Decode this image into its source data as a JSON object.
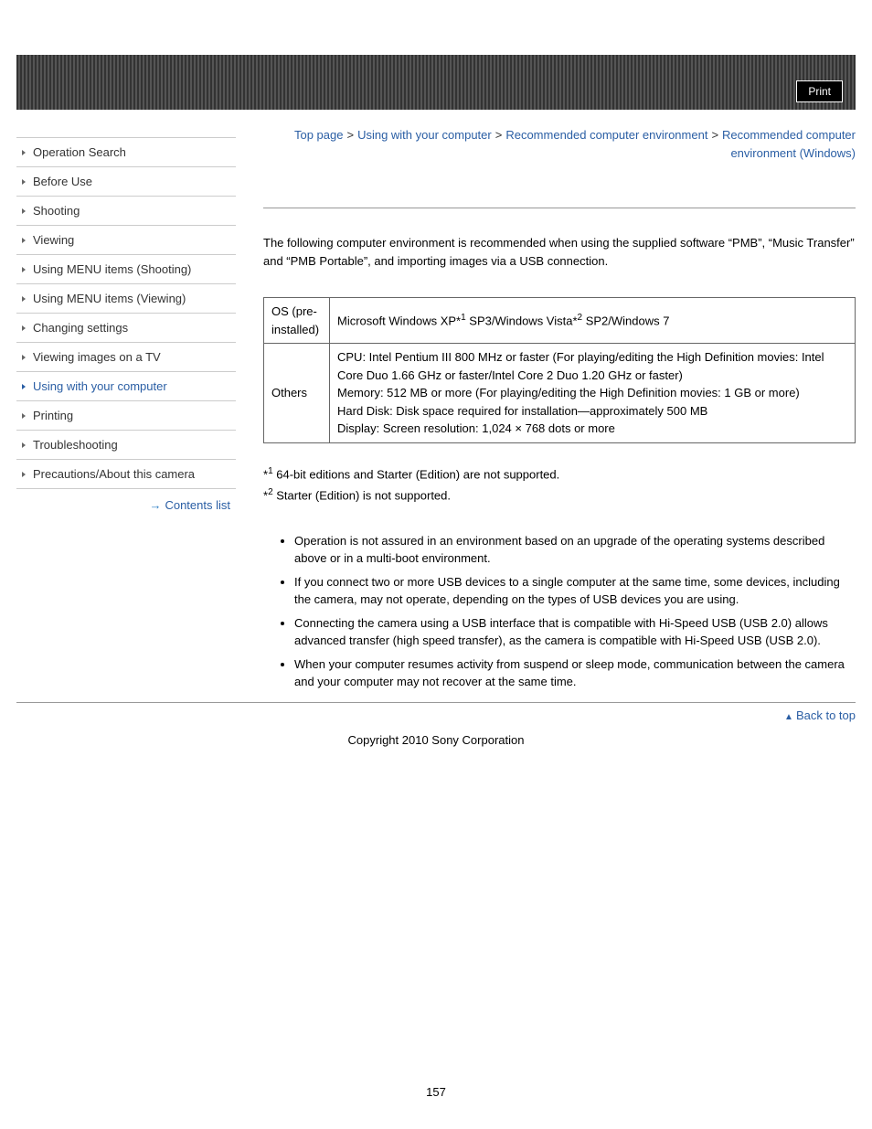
{
  "header": {
    "print": "Print"
  },
  "sidebar": {
    "items": [
      "Operation Search",
      "Before Use",
      "Shooting",
      "Viewing",
      "Using MENU items (Shooting)",
      "Using MENU items (Viewing)",
      "Changing settings",
      "Viewing images on a TV",
      "Using with your computer",
      "Printing",
      "Troubleshooting",
      "Precautions/About this camera"
    ],
    "contents_list": "Contents list"
  },
  "breadcrumb": {
    "l1": "Top page",
    "l2": "Using with your computer",
    "l3": "Recommended computer environment",
    "l4": "Recommended computer environment (Windows)",
    "sep": ">"
  },
  "intro": "The following computer environment is recommended when using the supplied software “PMB”, “Music Transfer” and “PMB Portable”, and importing images via a USB connection.",
  "table": {
    "r1": {
      "label": "OS (pre-installed)",
      "c1": "Microsoft Windows XP*",
      "sup1": "1",
      "c2": " SP3/Windows Vista*",
      "sup2": "2",
      "c3": " SP2/Windows 7"
    },
    "r2": {
      "label": "Others",
      "cpu": "CPU: Intel Pentium III 800 MHz or faster (For playing/editing the High Definition movies: Intel Core Duo 1.66 GHz or faster/Intel Core 2 Duo 1.20 GHz or faster)",
      "mem": "Memory: 512 MB or more (For playing/editing the High Definition movies: 1 GB or more)",
      "hdd": "Hard Disk: Disk space required for installation—approximately 500 MB",
      "disp": "Display: Screen resolution: 1,024 × 768 dots or more"
    }
  },
  "footnotes": {
    "f1": {
      "mark": "*",
      "sup": "1",
      "text": " 64-bit editions and Starter (Edition) are not supported."
    },
    "f2": {
      "mark": "*",
      "sup": "2",
      "text": " Starter (Edition) is not supported."
    }
  },
  "notes": [
    "Operation is not assured in an environment based on an upgrade of the operating systems described above or in a multi-boot environment.",
    "If you connect two or more USB devices to a single computer at the same time, some devices, including the camera, may not operate, depending on the types of USB devices you are using.",
    "Connecting the camera using a USB interface that is compatible with Hi-Speed USB (USB 2.0) allows advanced transfer (high speed transfer), as the camera is compatible with Hi-Speed USB (USB 2.0).",
    "When your computer resumes activity from suspend or sleep mode, communication between the camera and your computer may not recover at the same time."
  ],
  "back_to_top": "Back to top",
  "copyright": "Copyright 2010 Sony Corporation",
  "page_number": "157"
}
